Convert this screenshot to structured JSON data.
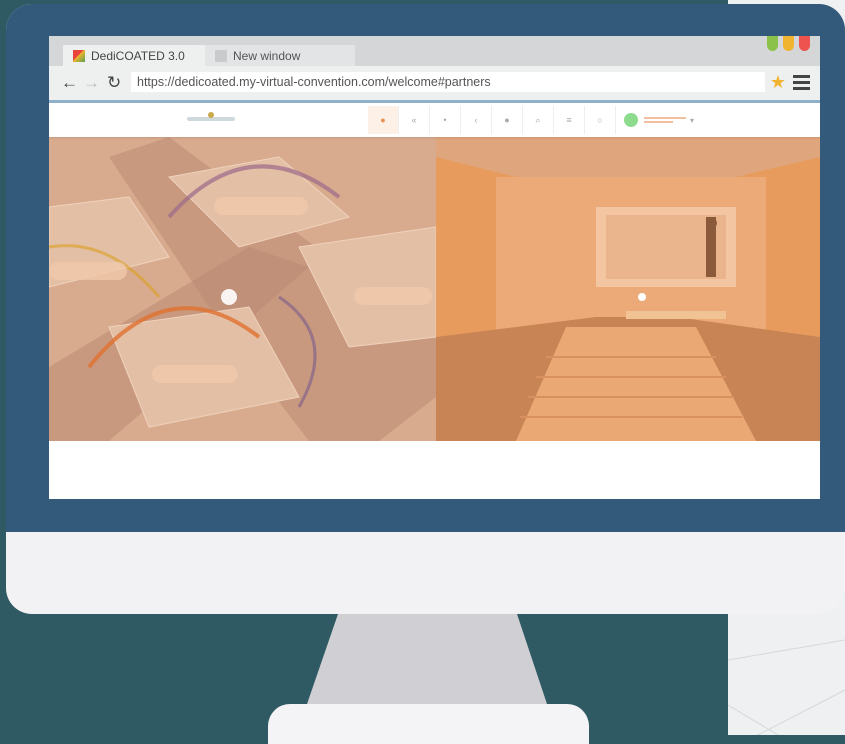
{
  "browser": {
    "tabs": [
      {
        "label": "DediCOATED 3.0",
        "active": true
      },
      {
        "label": "New window",
        "active": false
      }
    ],
    "url": "https://dedicoated.my-virtual-convention.com/welcome#partners",
    "window_controls": [
      "#8bc34a",
      "#f1b430",
      "#ef5350"
    ]
  },
  "icons": {
    "back": "arrow-left-icon",
    "forward": "arrow-right-icon",
    "reload": "reload-icon",
    "bookmark": "star-icon",
    "menu": "hamburger-menu-icon"
  },
  "colors": {
    "background": "#2f5a63",
    "bezel": "#345a7b",
    "venue_left": "#d9ab8e",
    "venue_right": "#e79c5e"
  }
}
